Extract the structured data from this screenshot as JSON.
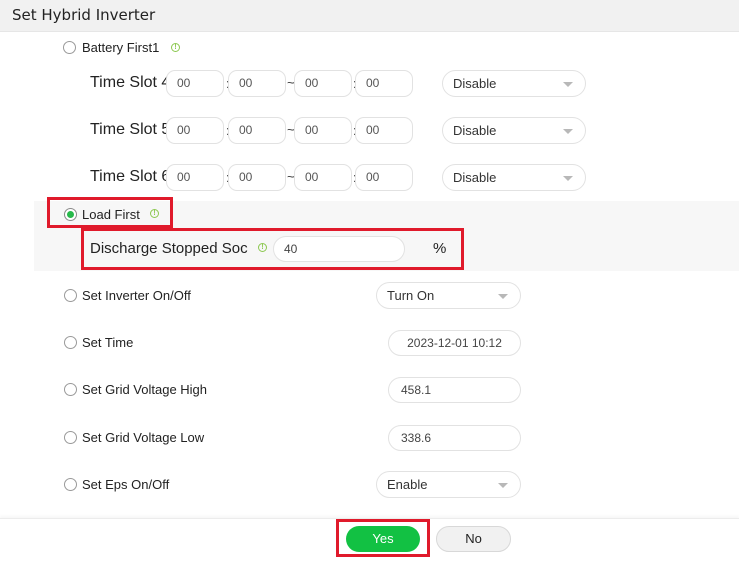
{
  "header": {
    "title": "Set Hybrid Inverter"
  },
  "battery_first": {
    "label": "Battery First1",
    "selected": false,
    "info_icon": "info-icon",
    "time_slots": [
      {
        "label": "Time Slot 4",
        "start_hour": "00",
        "start_min": "00",
        "end_hour": "00",
        "end_min": "00",
        "state": "Disable"
      },
      {
        "label": "Time Slot 5",
        "start_hour": "00",
        "start_min": "00",
        "end_hour": "00",
        "end_min": "00",
        "state": "Disable"
      },
      {
        "label": "Time Slot 6",
        "start_hour": "00",
        "start_min": "00",
        "end_hour": "00",
        "end_min": "00",
        "state": "Disable"
      }
    ],
    "colon": ":",
    "tilde": "~"
  },
  "load_first": {
    "label": "Load First",
    "selected": true,
    "discharge_label": "Discharge Stopped Soc",
    "discharge_value": "40",
    "unit": "%"
  },
  "options": [
    {
      "label": "Set Inverter On/Off",
      "type": "select",
      "value": "Turn On"
    },
    {
      "label": "Set Time",
      "type": "field",
      "value": "2023-12-01 10:12"
    },
    {
      "label": "Set Grid Voltage High",
      "type": "field",
      "value": "458.1"
    },
    {
      "label": "Set Grid Voltage Low",
      "type": "field",
      "value": "338.6"
    },
    {
      "label": "Set Eps On/Off",
      "type": "select",
      "value": "Enable"
    }
  ],
  "footer": {
    "yes_label": "Yes",
    "no_label": "No"
  },
  "colors": {
    "accent_green": "#12c143",
    "highlight_red": "#e01a2b",
    "info_green": "#8cc850"
  }
}
